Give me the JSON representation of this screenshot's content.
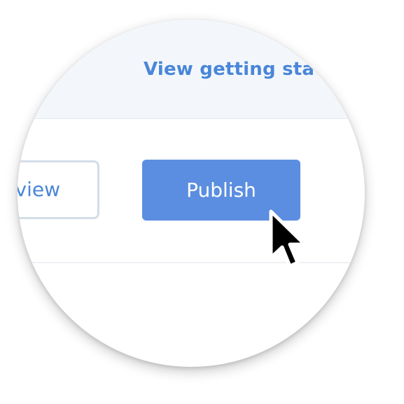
{
  "header": {
    "getting_started_link": "View getting sta"
  },
  "actions": {
    "preview_label": "view",
    "publish_label": "Publish"
  },
  "colors": {
    "accent": "#5b8ee0",
    "link": "#4a86d8",
    "header_bg": "#f3f7fb",
    "button_border": "#d3dde7"
  },
  "icons": {
    "cursor": "mouse-pointer-icon"
  }
}
